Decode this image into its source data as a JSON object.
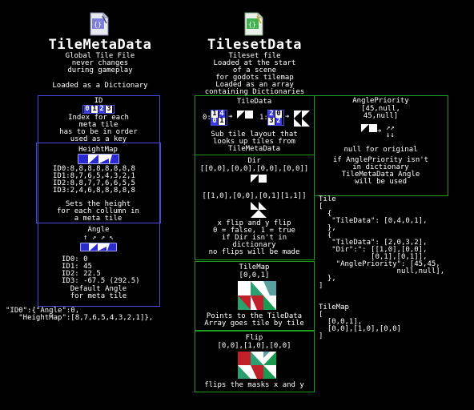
{
  "colors": {
    "blue_border": "#4a4ae0",
    "green_border": "#1e9c1e",
    "background": "#000000",
    "text": "#ffffff",
    "map_red": "#c0202a",
    "map_green": "#1a9a50",
    "map_teal": "#5aa0a0"
  },
  "left": {
    "title": "TileMetaData",
    "subtitle": [
      "Global Tile File",
      "never changes",
      "during gameplay"
    ],
    "loaded_as": "Loaded as a Dictionary",
    "id_box": {
      "heading": "ID",
      "digits": [
        "0",
        "1",
        "2",
        "3"
      ],
      "desc": [
        "Index for each",
        "meta tile",
        "has to be in order",
        "used as a key"
      ]
    },
    "heightmap_box": {
      "heading": "HeightMap",
      "rows": [
        "ID0:8,8,8,8,8,8,8,8",
        "ID1:8,7,6,5,4,3,2,1",
        "ID2:8,8,7,7,6,6,5,5",
        "ID3:2,4,6,8,8,8,8,8"
      ],
      "desc": [
        "Sets the height",
        "for each collumn in",
        "a meta tile"
      ]
    },
    "angle_box": {
      "heading": "Angle",
      "arrows": "↑ ↗ ↗ ↖",
      "rows": [
        "ID0: 0",
        "ID1: 45",
        "ID2: 22.5",
        "ID3: -67.5 (292.5)"
      ],
      "desc": [
        "Default Angle",
        "for meta tile"
      ]
    },
    "example": [
      "\"ID0\":{\"Angle\":0,",
      "   \"HeightMap\":[8,7,6,5,4,3,2,1]},"
    ]
  },
  "right": {
    "title": "TilesetData",
    "subtitle": [
      "Tileset file",
      "Loaded at the start",
      "of a scene",
      "for godots tilemap",
      "Loaded as an array",
      "containing Dictionaries"
    ],
    "tiledata_box": {
      "heading": "TileData",
      "label0": "0:",
      "grid0": [
        "1",
        "4",
        "0",
        "1"
      ],
      "label1": "1:",
      "grid1": [
        "2",
        "0",
        "3",
        "2"
      ],
      "desc": [
        "Sub tile layout that",
        "looks up tiles from",
        "TileMetaData"
      ]
    },
    "dir_box": {
      "heading": "Dir",
      "row1": "[[0,0],[0,0],[0,0],[0,0]]",
      "row2": "[[1,0],[0,0],[0,1][1,1]]",
      "desc": [
        "x flip and y flip",
        "0 = false, 1 = true",
        "if Dir isn't in",
        "dictionary",
        "no flips will be made"
      ]
    },
    "anglepriority_box": {
      "heading": "AnglePriority",
      "values": [
        "[45,null,",
        "45,null]"
      ],
      "desc": [
        "null for original",
        "if AnglePriority isn't",
        "in dictionary",
        "TileMetaData Angle",
        "will be used"
      ]
    },
    "tilemap_box": {
      "heading": "TileMap",
      "value": "[0,0,1]",
      "desc": [
        "Points to the TileData",
        "Array goes tile by tile"
      ]
    },
    "flip_box": {
      "heading": "Flip",
      "value": "[0,0],[1,0],[0,0]",
      "desc": [
        "flips the masks x and y"
      ]
    },
    "code_tile": [
      "Tile",
      "[",
      "  {",
      "   \"TileData\": [0,4,0,1],",
      "  },",
      "  {",
      "   \"TileData\": [2,0,3,2],",
      "   \"Dir\":\": [[1,0],[0,0],",
      "            [0,1],[0,1]],",
      "    \"AnglePriority\": [45,45,",
      "                  null,null],",
      "  },",
      "]"
    ],
    "code_tilemap": [
      "TileMap",
      "[",
      "  [0,0,1],",
      "  [0,0],[1,0],[0,0]",
      "]"
    ]
  }
}
